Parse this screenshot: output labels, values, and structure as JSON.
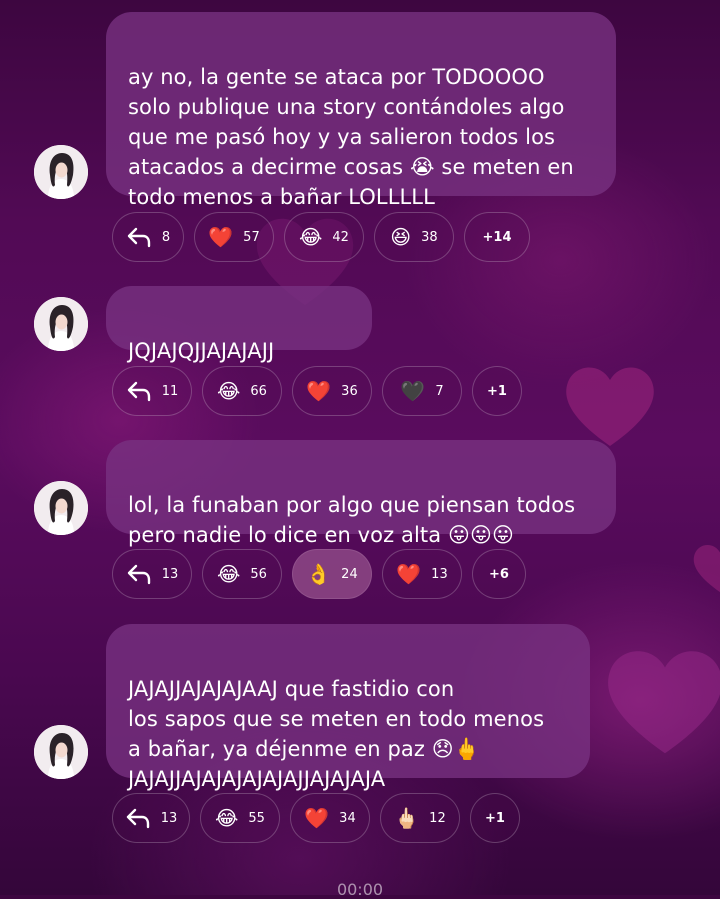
{
  "colors": {
    "background": "#4a0850",
    "bubble": "#7a3484",
    "heart_react": "#e0102a",
    "text": "#ffffff"
  },
  "messages": [
    {
      "text": "ay no, la gente se ataca por TODOOOO\nsolo publique una story contándoles algo\nque me pasó hoy y ya salieron todos los\natacados a decirme cosas 😭 se meten en\ntodo menos a bañar LOLLLLL",
      "reply_count": "8",
      "reactions": [
        {
          "emoji": "❤️",
          "count": "57",
          "icon": "red-heart-icon"
        },
        {
          "emoji": "😂",
          "count": "42",
          "icon": "joy-face-icon"
        },
        {
          "emoji": "😆",
          "count": "38",
          "icon": "laughing-face-icon"
        }
      ],
      "more": "+14"
    },
    {
      "text": "JQJAJQJJAJAJAJJ",
      "reply_count": "11",
      "reactions": [
        {
          "emoji": "😂",
          "count": "66",
          "icon": "joy-face-icon"
        },
        {
          "emoji": "❤️",
          "count": "36",
          "icon": "red-heart-icon"
        },
        {
          "emoji": "🖤",
          "count": "7",
          "icon": "black-heart-icon"
        }
      ],
      "more": "+1"
    },
    {
      "text": "lol, la funaban por algo que piensan todos\npero nadie lo dice en voz alta 😛😛😛",
      "reply_count": "13",
      "reactions": [
        {
          "emoji": "😂",
          "count": "56",
          "icon": "joy-face-icon"
        },
        {
          "emoji": "👌",
          "count": "24",
          "icon": "ok-hand-icon",
          "highlighted": true
        },
        {
          "emoji": "❤️",
          "count": "13",
          "icon": "red-heart-icon"
        }
      ],
      "more": "+6"
    },
    {
      "text": "JAJAJJAJAJAJAAJ que fastidio con\nlos sapos que se meten en todo menos\na bañar, ya déjenme en paz 😞🖕\nJAJAJJAJAJAJAJAJAJJAJAJAJA",
      "reply_count": "13",
      "reactions": [
        {
          "emoji": "😂",
          "count": "55",
          "icon": "joy-face-icon"
        },
        {
          "emoji": "❤️",
          "count": "34",
          "icon": "red-heart-icon"
        },
        {
          "emoji": "🖕🏻",
          "count": "12",
          "icon": "middle-finger-icon"
        }
      ],
      "more": "+1"
    }
  ],
  "timestamp": "00:00"
}
